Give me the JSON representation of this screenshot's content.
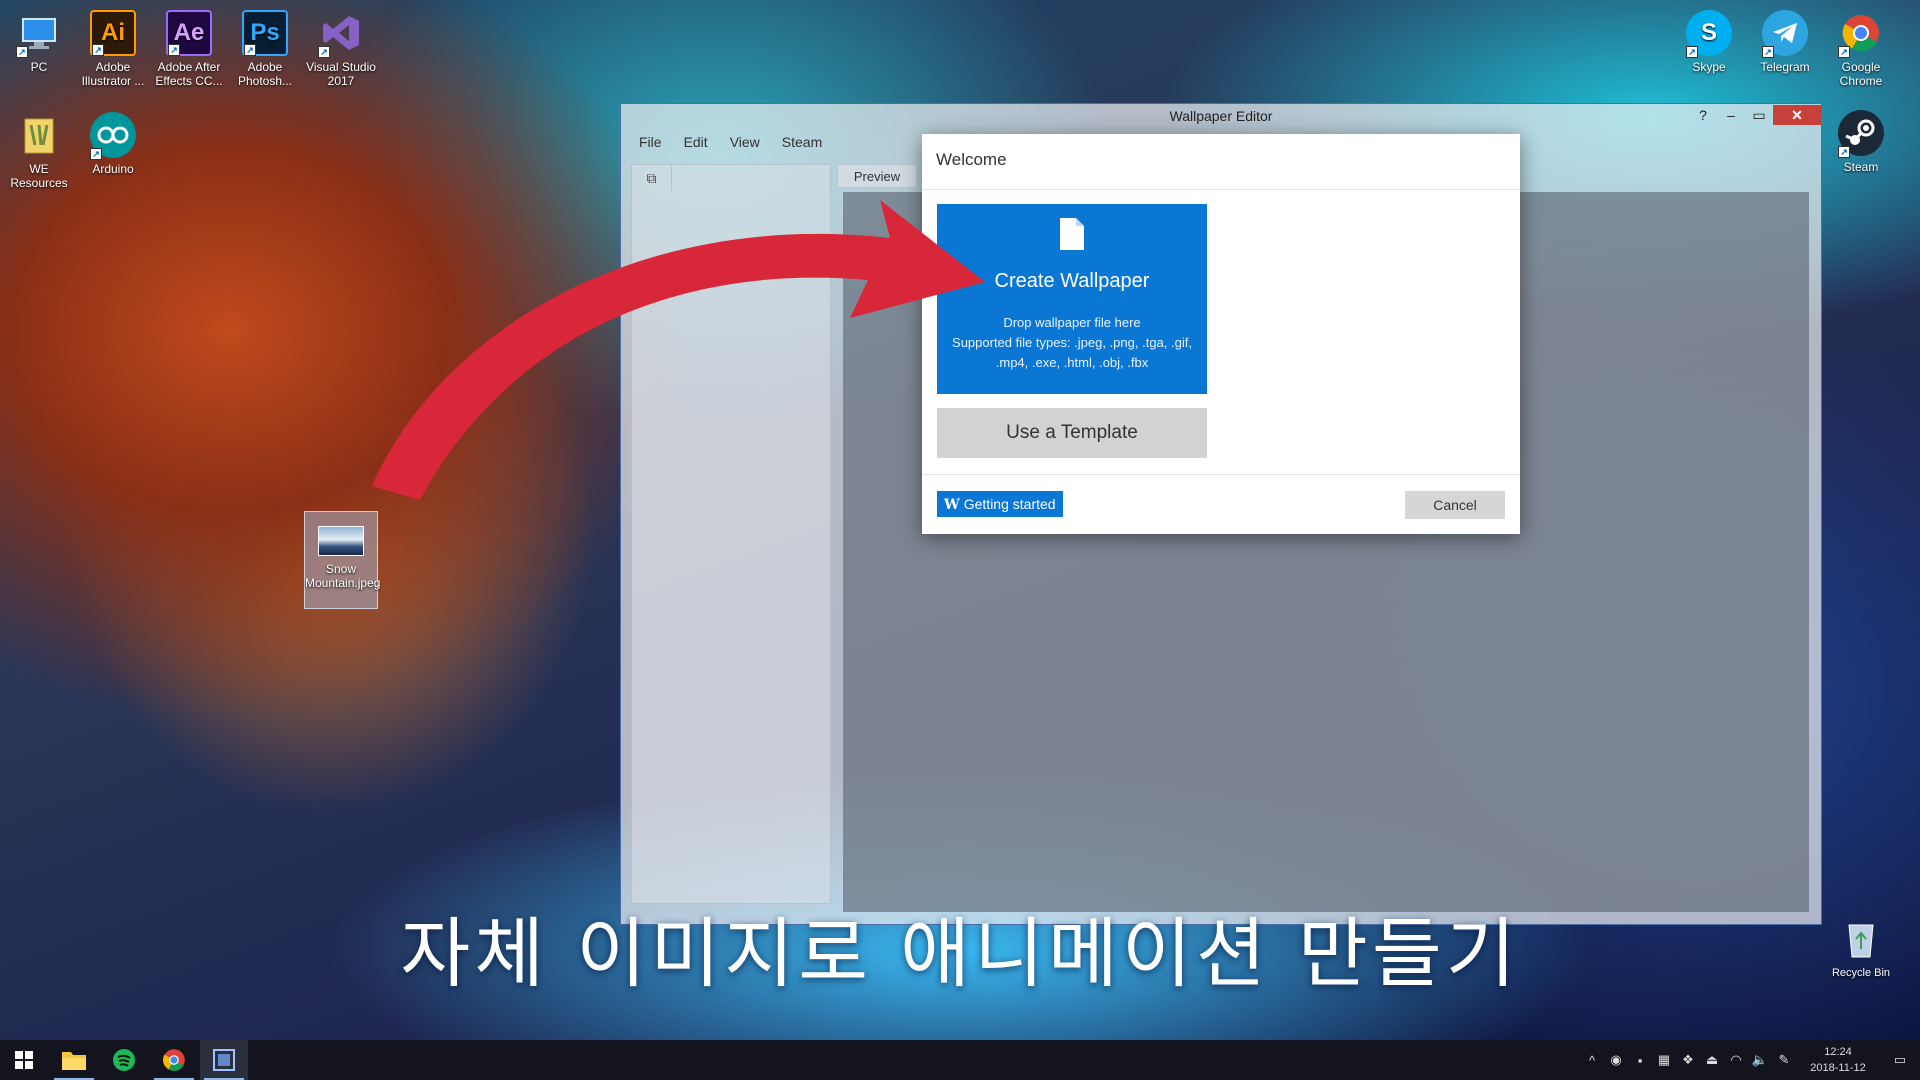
{
  "desktop": {
    "icons_left": [
      {
        "label": "PC"
      },
      {
        "label": "Adobe Illustrator ...",
        "glyph": "Ai"
      },
      {
        "label": "Adobe After Effects CC...",
        "glyph": "Ae"
      },
      {
        "label": "Adobe Photosh...",
        "glyph": "Ps"
      },
      {
        "label": "Visual Studio 2017"
      },
      {
        "label": "WE Resources"
      },
      {
        "label": "Arduino"
      }
    ],
    "icons_right": [
      {
        "label": "Skype",
        "glyph": "S"
      },
      {
        "label": "Telegram"
      },
      {
        "label": "Google Chrome"
      },
      {
        "label": "Steam"
      },
      {
        "label": "Recycle Bin"
      }
    ],
    "dropped_file": {
      "label": "Snow Mountain.jpeg"
    }
  },
  "editor": {
    "title": "Wallpaper Editor",
    "help": "?",
    "menu": [
      "File",
      "Edit",
      "View",
      "Steam"
    ],
    "preview_tab": "Preview"
  },
  "dialog": {
    "title": "Welcome",
    "create": {
      "title": "Create Wallpaper",
      "drop_line1": "Drop wallpaper file here",
      "drop_line2": "Supported file types: .jpeg, .png, .tga, .gif, .mp4, .exe, .html, .obj, .fbx"
    },
    "template_label": "Use a Template",
    "getting_started_label": "Getting started",
    "getting_started_glyph": "W",
    "cancel_label": "Cancel"
  },
  "subtitle": "자체 이미지로 애니메이션 만들기",
  "taskbar": {
    "time": "12:24",
    "date": "2018-11-12"
  },
  "colors": {
    "accent": "#0b77d4",
    "arrow": "#d9273a",
    "close": "#c7403a"
  }
}
